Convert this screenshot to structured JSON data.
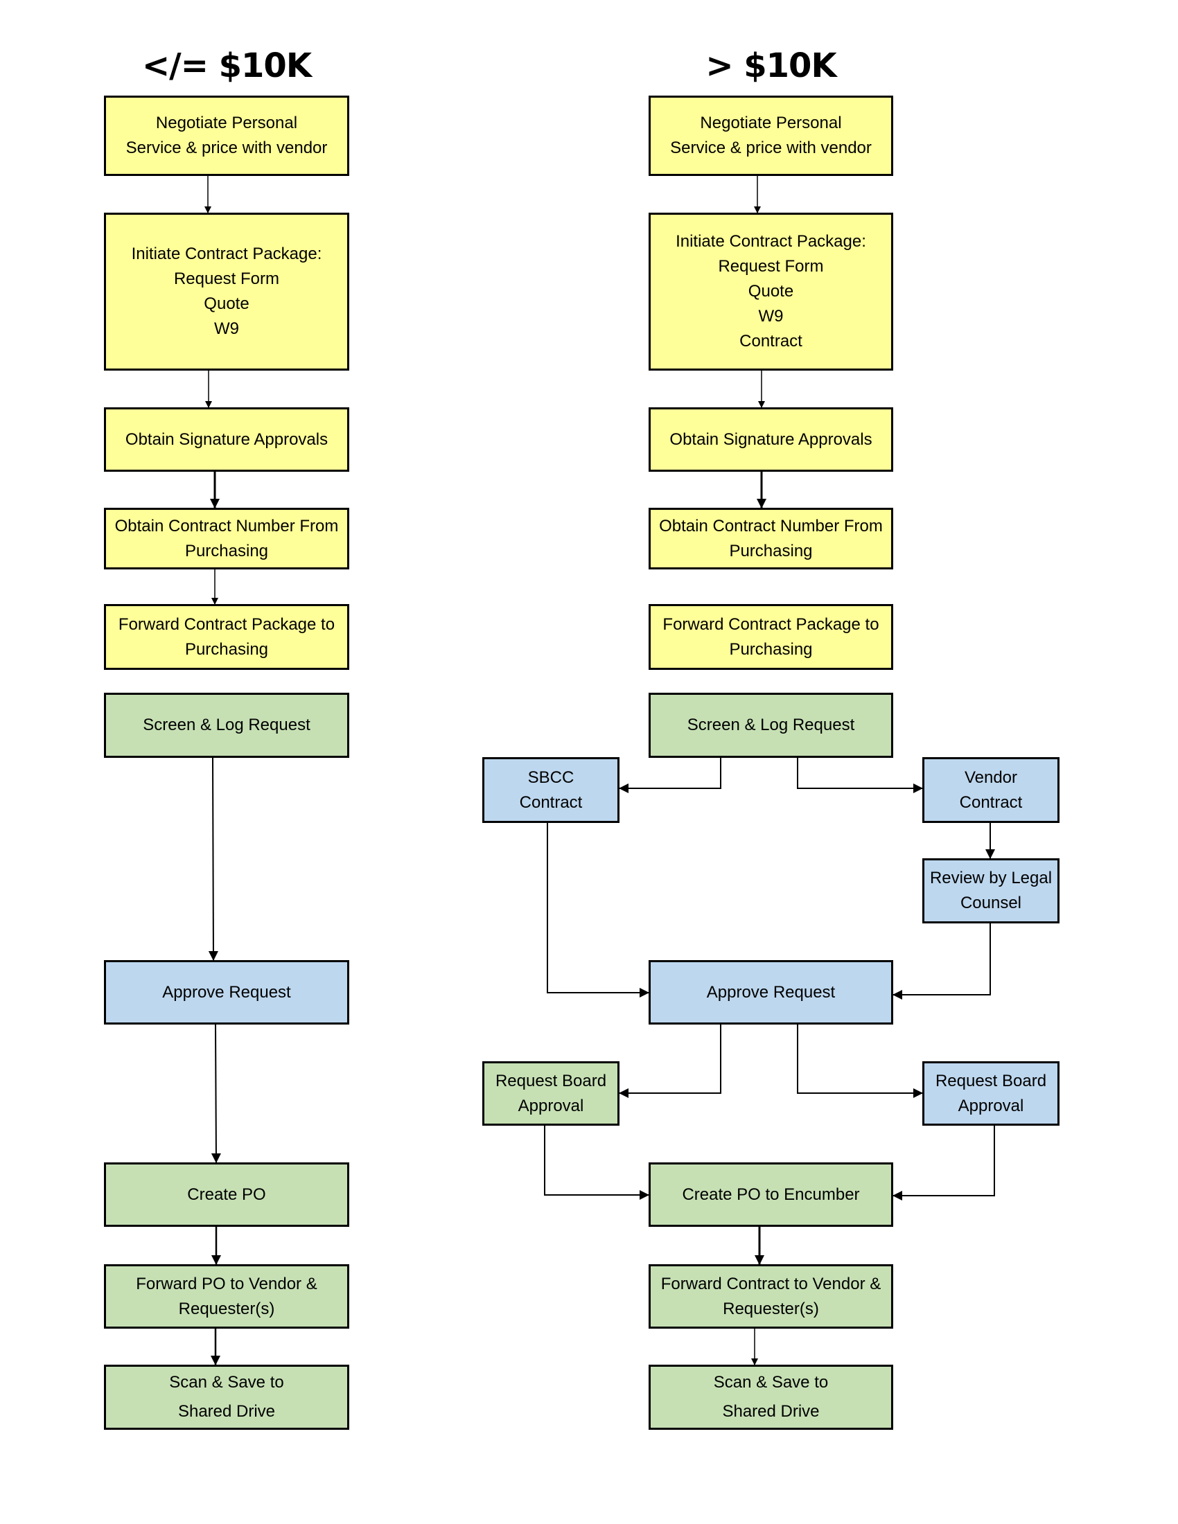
{
  "colors": {
    "yellow": "#FFFF99",
    "green": "#C6E0B4",
    "blue": "#BDD7EE",
    "border": "#000000"
  },
  "left": {
    "title": "</= $10K",
    "steps": [
      {
        "id": "L1",
        "label": "Negotiate Personal\nService & price with vendor",
        "color": "yellow"
      },
      {
        "id": "L2",
        "label": "Initiate Contract Package:\nRequest Form\nQuote\nW9",
        "color": "yellow"
      },
      {
        "id": "L3",
        "label": "Obtain Signature Approvals",
        "color": "yellow"
      },
      {
        "id": "L4",
        "label": "Obtain Contract Number From\nPurchasing",
        "color": "yellow"
      },
      {
        "id": "L5",
        "label": "Forward Contract Package to\nPurchasing",
        "color": "yellow"
      },
      {
        "id": "L6",
        "label": "Screen & Log Request",
        "color": "green"
      },
      {
        "id": "L7",
        "label": "Approve Request",
        "color": "blue"
      },
      {
        "id": "L8",
        "label": "Create PO",
        "color": "green"
      },
      {
        "id": "L9",
        "label": "Forward PO to Vendor &\nRequester(s)",
        "color": "green"
      },
      {
        "id": "L10",
        "label": "Scan & Save to\nShared  Drive",
        "color": "green"
      }
    ]
  },
  "right": {
    "title": "> $10K",
    "steps": [
      {
        "id": "R1",
        "label": "Negotiate Personal\nService & price with vendor",
        "color": "yellow"
      },
      {
        "id": "R2",
        "label": "Initiate Contract Package:\nRequest Form\nQuote\nW9\nContract",
        "color": "yellow"
      },
      {
        "id": "R3",
        "label": "Obtain Signature Approvals",
        "color": "yellow"
      },
      {
        "id": "R4",
        "label": "Obtain Contract Number From\nPurchasing",
        "color": "yellow"
      },
      {
        "id": "R5",
        "label": "Forward Contract Package to\nPurchasing",
        "color": "yellow"
      },
      {
        "id": "R6",
        "label": "Screen & Log Request",
        "color": "green"
      },
      {
        "id": "R7",
        "label": "Approve Request",
        "color": "blue"
      },
      {
        "id": "R8",
        "label": "Create PO to Encumber",
        "color": "green"
      },
      {
        "id": "R9",
        "label": "Forward Contract to Vendor &\nRequester(s)",
        "color": "green"
      },
      {
        "id": "R10",
        "label": "Scan & Save to\nShared  Drive",
        "color": "green"
      }
    ],
    "branches": [
      {
        "id": "SBCC",
        "label": "SBCC\nContract",
        "color": "blue"
      },
      {
        "id": "VENDOR",
        "label": "Vendor\nContract",
        "color": "blue"
      },
      {
        "id": "LEGAL",
        "label": "Review by Legal\nCounsel",
        "color": "blue"
      },
      {
        "id": "BOARD_L",
        "label": "Request Board\nApproval",
        "color": "green"
      },
      {
        "id": "BOARD_R",
        "label": "Request Board\nApproval",
        "color": "blue"
      }
    ]
  },
  "edges": [
    {
      "from": "L1",
      "to": "L2"
    },
    {
      "from": "L2",
      "to": "L3"
    },
    {
      "from": "L3",
      "to": "L4"
    },
    {
      "from": "L4",
      "to": "L5"
    },
    {
      "from": "L6",
      "to": "L7"
    },
    {
      "from": "L7",
      "to": "L8"
    },
    {
      "from": "L8",
      "to": "L9"
    },
    {
      "from": "L9",
      "to": "L10"
    },
    {
      "from": "R1",
      "to": "R2"
    },
    {
      "from": "R2",
      "to": "R3"
    },
    {
      "from": "R3",
      "to": "R4"
    },
    {
      "from": "R6",
      "to": "SBCC"
    },
    {
      "from": "R6",
      "to": "VENDOR"
    },
    {
      "from": "VENDOR",
      "to": "LEGAL"
    },
    {
      "from": "SBCC",
      "to": "R7"
    },
    {
      "from": "LEGAL",
      "to": "R7"
    },
    {
      "from": "R7",
      "to": "BOARD_L"
    },
    {
      "from": "R7",
      "to": "BOARD_R"
    },
    {
      "from": "BOARD_L",
      "to": "R8"
    },
    {
      "from": "BOARD_R",
      "to": "R8"
    },
    {
      "from": "R8",
      "to": "R9"
    },
    {
      "from": "R9",
      "to": "R10"
    }
  ]
}
